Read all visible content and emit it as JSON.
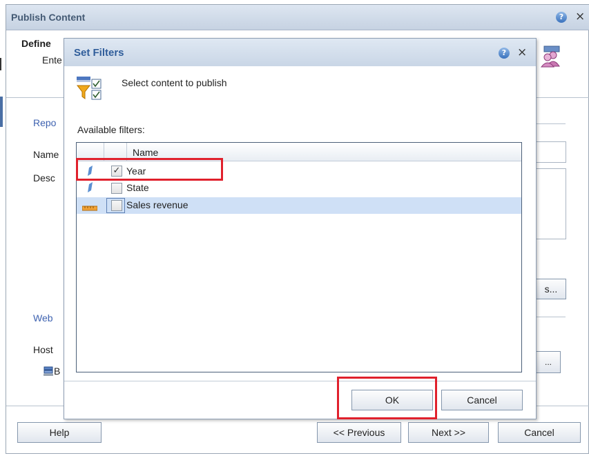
{
  "outer_dialog": {
    "title": "Publish Content",
    "help_icon": "?",
    "close_icon": "×",
    "define_text": "Define",
    "enter_text": "Ente",
    "report_section": "Repo",
    "name_label": "Name",
    "description_label": "Desc",
    "web_section": "Web",
    "host_label": "Host",
    "browse_label": "B",
    "side_button_1": "s...",
    "side_button_2": "...",
    "buttons": {
      "help": "Help",
      "previous": "<< Previous",
      "next": "Next >>",
      "cancel": "Cancel"
    }
  },
  "set_filters_dialog": {
    "title": "Set Filters",
    "help_icon": "?",
    "close_icon": "×",
    "instruction": "Select content to publish",
    "available_label": "Available filters:",
    "columns": [
      "",
      "",
      "Name"
    ],
    "filters": [
      {
        "name": "Year",
        "checked": true,
        "icon": "dimension-icon",
        "selected": false
      },
      {
        "name": "State",
        "checked": false,
        "icon": "dimension-icon",
        "selected": false
      },
      {
        "name": "Sales revenue",
        "checked": false,
        "icon": "measure-icon",
        "selected": true
      }
    ],
    "ok_label": "OK",
    "cancel_label": "Cancel"
  },
  "colors": {
    "highlight_red": "#e0202c",
    "selected_row": "#cfe0f6",
    "title_blue": "#2f5d9a"
  }
}
